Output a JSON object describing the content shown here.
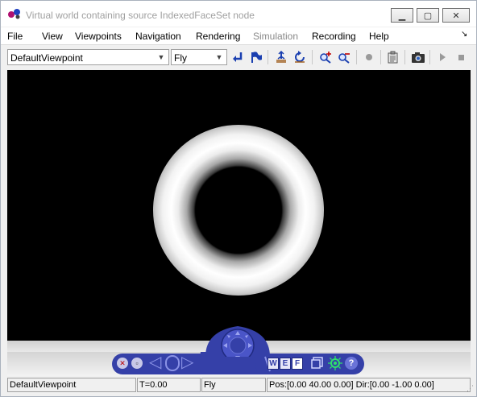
{
  "window": {
    "title": "Virtual world containing source IndexedFaceSet node"
  },
  "menu": {
    "items": [
      "File",
      "View",
      "Viewpoints",
      "Navigation",
      "Rendering",
      "Simulation",
      "Recording",
      "Help"
    ],
    "disabled": [
      "Simulation"
    ]
  },
  "toolbar": {
    "viewpoint_combo_value": "DefaultViewpoint",
    "navigation_combo_value": "Fly",
    "icons": [
      "return-to-viewpoint-icon",
      "create-viewpoint-icon",
      "go-to-default-viewpoint-icon",
      "straighten-up-icon",
      "zoom-in-icon",
      "zoom-out-icon",
      "record-icon",
      "edit-icon",
      "snapshot-icon",
      "play-icon",
      "stop-icon"
    ]
  },
  "navpanel": {
    "buttons": {
      "walk": "W",
      "examine": "E",
      "fly": "F",
      "help": "?"
    }
  },
  "status": {
    "viewpoint": "DefaultViewpoint",
    "time": "T=0.00",
    "nav_mode": "Fly",
    "position": "Pos:[0.00 40.00 0.00] Dir:[0.00 -1.00 0.00]"
  },
  "colors": {
    "nav_blue": "#3540a8",
    "viewport_bg": "#000000",
    "toolbar_icon_blue": "#1a3fb0"
  }
}
